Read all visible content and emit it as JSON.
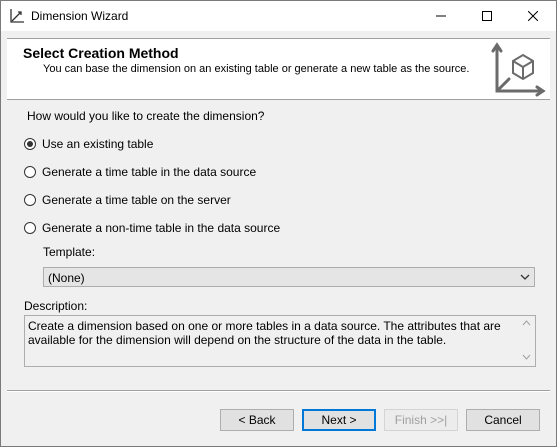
{
  "window": {
    "title": "Dimension Wizard"
  },
  "header": {
    "title": "Select Creation Method",
    "subtitle": "You can base the dimension on an existing table or generate a new table as the source."
  },
  "question": "How would you like to create the dimension?",
  "options": [
    {
      "label": "Use an existing table",
      "checked": true
    },
    {
      "label": "Generate a time table in the data source",
      "checked": false
    },
    {
      "label": "Generate a time table on the server",
      "checked": false
    },
    {
      "label": "Generate a non-time table in the data source",
      "checked": false
    }
  ],
  "template": {
    "label": "Template:",
    "value": "(None)"
  },
  "description": {
    "label": "Description:",
    "text": "Create a dimension based on one or more tables in a data source. The attributes that are available for the dimension will depend on the structure of the data in the table."
  },
  "buttons": {
    "back": "< Back",
    "next": "Next >",
    "finish": "Finish >>|",
    "cancel": "Cancel"
  }
}
